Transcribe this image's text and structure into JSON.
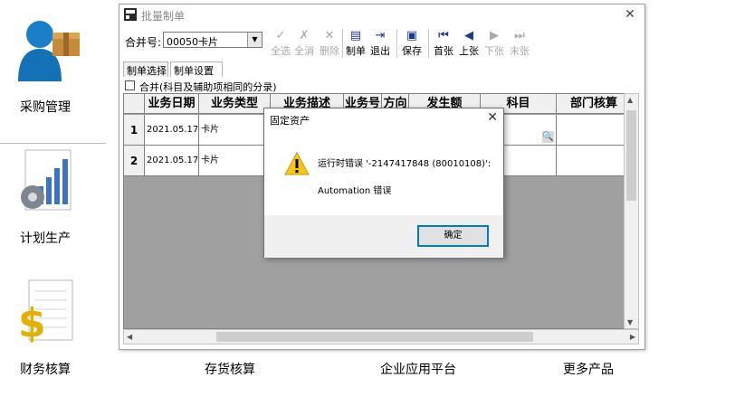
{
  "launcher": {
    "purchase": "采购管理",
    "production": "计划生产",
    "finance": "财务核算"
  },
  "bottom_nav": {
    "inventory": "存货核算",
    "enterprise": "企业应用平台",
    "more": "更多产品"
  },
  "window": {
    "title": "批量制单",
    "toolbar": {
      "merge_label": "合并号:",
      "merge_value": "00050卡片",
      "buttons": [
        {
          "label": "全选",
          "icon": "select-all-icon",
          "enabled": false
        },
        {
          "label": "全消",
          "icon": "deselect-all-icon",
          "enabled": false
        },
        {
          "label": "删除",
          "icon": "delete-icon",
          "enabled": false
        },
        {
          "label": "制单",
          "icon": "make-voucher-icon",
          "enabled": true
        },
        {
          "label": "退出",
          "icon": "exit-icon",
          "enabled": true
        },
        {
          "label": "保存",
          "icon": "save-icon",
          "enabled": true
        },
        {
          "label": "首张",
          "icon": "first-icon",
          "enabled": true
        },
        {
          "label": "上张",
          "icon": "prev-icon",
          "enabled": true
        },
        {
          "label": "下张",
          "icon": "next-icon",
          "enabled": false
        },
        {
          "label": "末张",
          "icon": "last-icon",
          "enabled": false
        }
      ]
    },
    "tabs": [
      "制单选择",
      "制单设置"
    ],
    "merge_checkbox": "合并(科目及辅助项相同的分录)",
    "grid": {
      "headers": [
        "业务日期",
        "业务类型",
        "业务描述",
        "业务号",
        "方向",
        "发生额",
        "科目",
        "部门核算"
      ],
      "rows": [
        {
          "num": "1",
          "date": "2021.05.17",
          "type": "卡片"
        },
        {
          "num": "2",
          "date": "2021.05.17",
          "type": "卡片"
        }
      ]
    }
  },
  "dialog": {
    "title": "固定资产",
    "message1": "运行时错误 '-2147417848 (80010108)':",
    "message2": "Automation 错误",
    "ok": "确定"
  }
}
